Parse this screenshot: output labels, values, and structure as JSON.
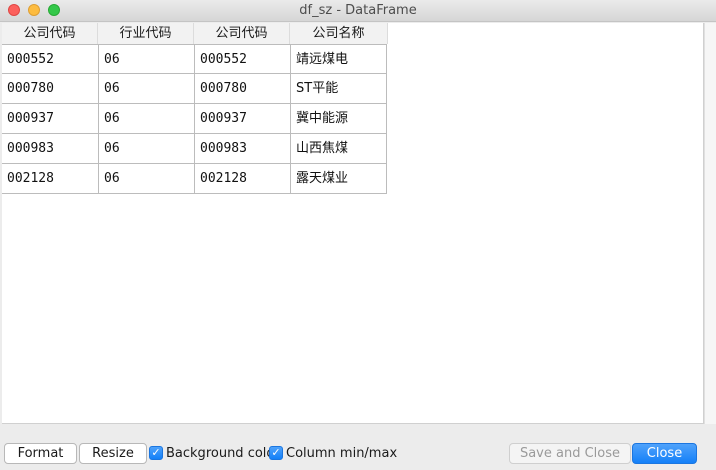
{
  "window": {
    "title": "df_sz - DataFrame"
  },
  "table": {
    "columns": [
      "公司代码",
      "行业代码",
      "公司代码",
      "公司名称"
    ],
    "rows": [
      [
        "000552",
        "06",
        "000552",
        "靖远煤电"
      ],
      [
        "000780",
        "06",
        "000780",
        "ST平能"
      ],
      [
        "000937",
        "06",
        "000937",
        "冀中能源"
      ],
      [
        "000983",
        "06",
        "000983",
        "山西焦煤"
      ],
      [
        "002128",
        "06",
        "002128",
        "露天煤业"
      ]
    ]
  },
  "footer": {
    "format_label": "Format",
    "resize_label": "Resize",
    "background_color_label": "Background colo",
    "background_color_checked": true,
    "column_minmax_label": "Column min/max",
    "column_minmax_checked": true,
    "save_close_label": "Save and Close",
    "close_label": "Close"
  },
  "icons": {
    "checkmark": "✓"
  },
  "colors": {
    "accent": "#1480f8",
    "close_dot": "#fc605c",
    "minimize_dot": "#fdbc40",
    "maximize_dot": "#34c84a"
  }
}
